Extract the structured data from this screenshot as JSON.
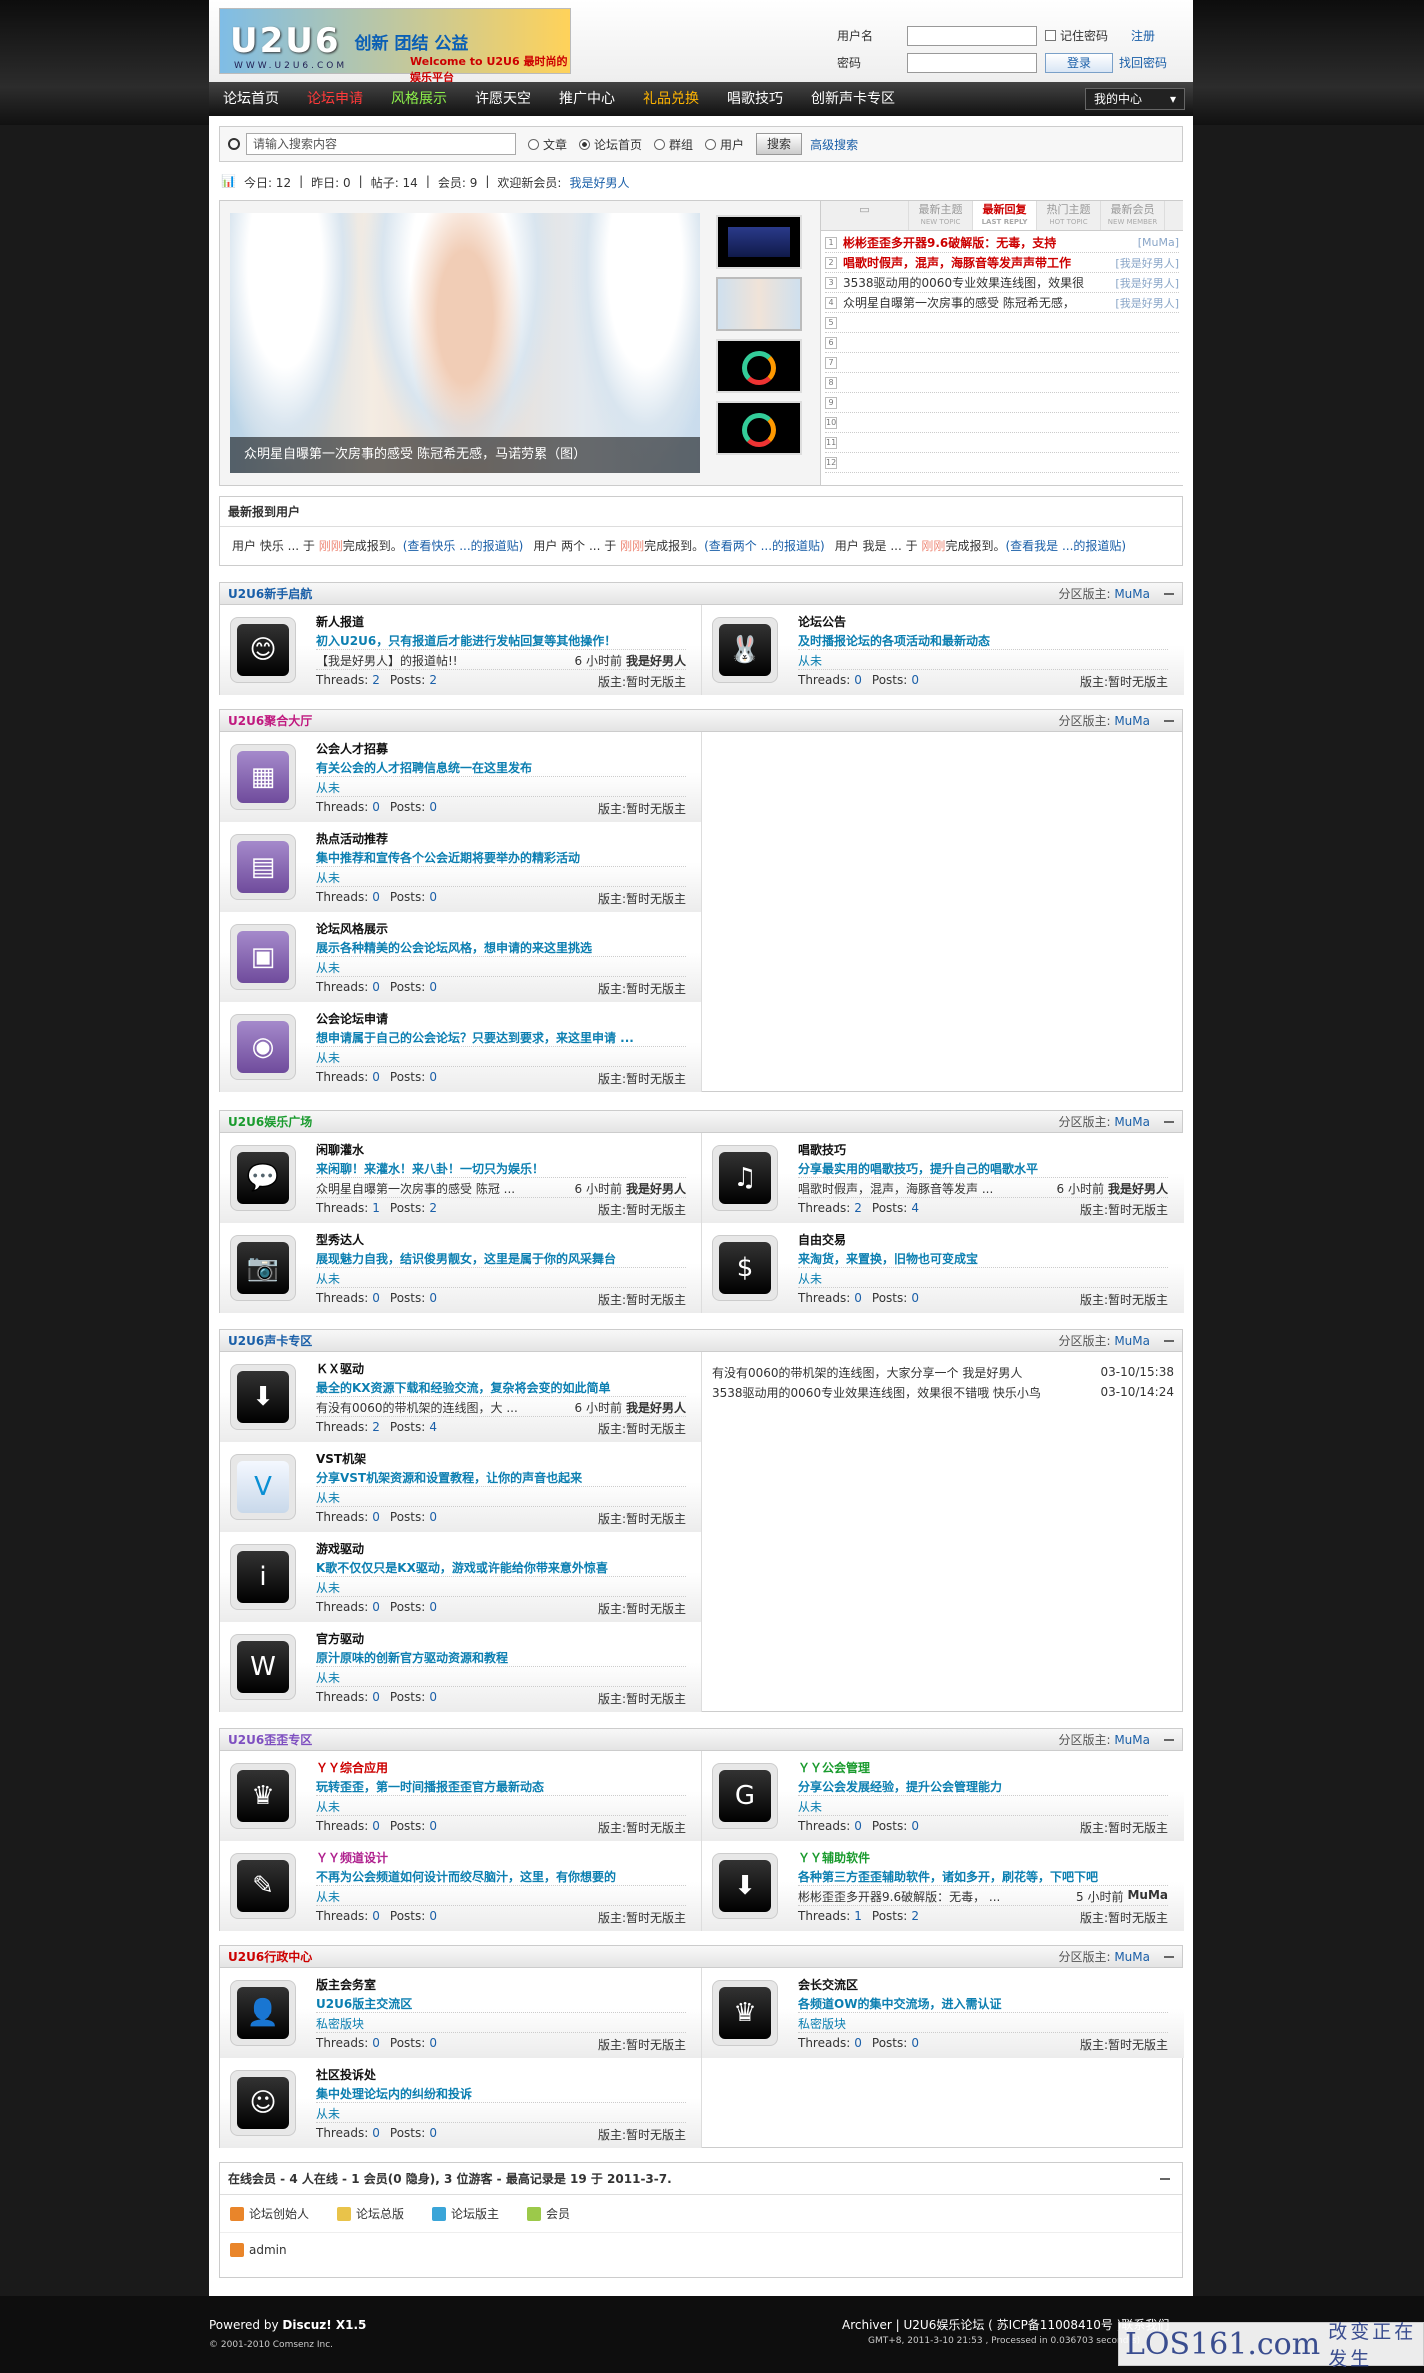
{
  "header": {
    "logo_text": "U2U6",
    "logo_slogan": "创新 团结 公益",
    "logo_sub": "Welcome to U2U6 最时尚的娱乐平台",
    "logo_url": "WWW.U2U6.COM",
    "username_label": "用户名",
    "password_label": "密码",
    "remember_label": "记住密码",
    "register_link": "注册",
    "login_button": "登录",
    "forgot_link": "找回密码"
  },
  "nav": {
    "items": [
      "论坛首页",
      "论坛申请",
      "风格展示",
      "许愿天空",
      "推广中心",
      "礼品兑换",
      "唱歌技巧",
      "创新声卡专区"
    ],
    "my_center": "我的中心"
  },
  "search": {
    "placeholder": "请输入搜索内容",
    "options": [
      "文章",
      "论坛首页",
      "群组",
      "用户"
    ],
    "button": "搜索",
    "advanced": "高级搜索"
  },
  "stats": {
    "today": "今日: 12",
    "yesterday": "昨日: 0",
    "posts": "帖子: 14",
    "members": "会员: 9",
    "welcome": "欢迎新会员:",
    "newest": "我是好男人"
  },
  "slideshow": {
    "caption": "众明星自曝第一次房事的感受 陈冠希无感，马诺劳累（图）"
  },
  "hot": {
    "tabs": [
      {
        "cn": "最新主题",
        "en": "NEW TOPIC"
      },
      {
        "cn": "最新回复",
        "en": "LAST REPLY"
      },
      {
        "cn": "热门主题",
        "en": "HOT TOPIC"
      },
      {
        "cn": "最新会员",
        "en": "NEW MEMBER"
      }
    ],
    "items": [
      {
        "n": "1",
        "title": "彬彬歪歪多开器9.6破解版：无毒，支持",
        "author": "[MuMa]",
        "red": true
      },
      {
        "n": "2",
        "title": "唱歌时假声，混声，海豚音等发声声带工作",
        "author": "[我是好男人]",
        "red": true
      },
      {
        "n": "3",
        "title": "3538驱动用的0060专业效果连线图，效果很",
        "author": "[我是好男人]",
        "red": false
      },
      {
        "n": "4",
        "title": "众明星自曝第一次房事的感受 陈冠希无感，",
        "author": "[我是好男人]",
        "red": false
      },
      {
        "n": "5",
        "title": "",
        "author": "",
        "red": false
      },
      {
        "n": "6",
        "title": "",
        "author": "",
        "red": false
      },
      {
        "n": "7",
        "title": "",
        "author": "",
        "red": false
      },
      {
        "n": "8",
        "title": "",
        "author": "",
        "red": false
      },
      {
        "n": "9",
        "title": "",
        "author": "",
        "red": false
      },
      {
        "n": "10",
        "title": "",
        "author": "",
        "red": false
      },
      {
        "n": "11",
        "title": "",
        "author": "",
        "red": false
      },
      {
        "n": "12",
        "title": "",
        "author": "",
        "red": false
      }
    ]
  },
  "newusers": {
    "title": "最新报到用户",
    "entries": [
      {
        "a": "用户 快乐 ... 于 ",
        "t": "刚刚",
        "b": "完成报到。",
        "link": "(查看快乐 ...的报道贴)"
      },
      {
        "a": "用户 两个 ... 于 ",
        "t": "刚刚",
        "b": "完成报到。",
        "link": "(查看两个 ...的报道贴)"
      },
      {
        "a": "用户 我是 ... 于 ",
        "t": "刚刚",
        "b": "完成报到。",
        "link": "(查看我是 ...的报道贴)"
      }
    ]
  },
  "common": {
    "mod_label": "分区版主:",
    "mod_name": "MuMa",
    "threads": "Threads:",
    "posts": "Posts:",
    "forum_mod": "版主:暂时无版主",
    "never": "从未",
    "private": "私密版块"
  },
  "groups": [
    {
      "title": "U2U6新手启航",
      "color": "#1a5fa8",
      "forums": [
        {
          "name": "新人报道",
          "desc": "初入U2U6，只有报道后才能进行发帖回复等其他操作！",
          "last": "【我是好男人】的报道帖!!",
          "ago": "6 小时前",
          "by": "我是好男人",
          "threads": "2",
          "posts": "2"
        },
        {
          "name": "论坛公告",
          "desc": "及时播报论坛的各项活动和最新动态",
          "last": "从未",
          "ago": "",
          "by": "",
          "threads": "0",
          "posts": "0"
        }
      ]
    },
    {
      "title": "U2U6聚合大厅",
      "color": "#c0197f",
      "forums": [
        {
          "name": "公会人才招募",
          "desc": "有关公会的人才招聘信息统一在这里发布",
          "last": "从未",
          "ago": "",
          "by": "",
          "threads": "0",
          "posts": "0"
        },
        {
          "name": "热点活动推荐",
          "desc": "集中推荐和宣传各个公会近期将要举办的精彩活动",
          "last": "从未",
          "ago": "",
          "by": "",
          "threads": "0",
          "posts": "0"
        },
        {
          "name": "论坛风格展示",
          "desc": "展示各种精美的公会论坛风格，想申请的来这里挑选",
          "last": "从未",
          "ago": "",
          "by": "",
          "threads": "0",
          "posts": "0"
        },
        {
          "name": "公会论坛申请",
          "desc": "想申请属于自己的公会论坛？只要达到要求，来这里申请 ...",
          "last": "从未",
          "ago": "",
          "by": "",
          "threads": "0",
          "posts": "0"
        }
      ]
    },
    {
      "title": "U2U6娱乐广场",
      "color": "#1a9b2e",
      "forums": [
        {
          "name": "闲聊灌水",
          "desc": "来闲聊！来灌水！来八卦！一切只为娱乐！",
          "last": "众明星自曝第一次房事的感受 陈冠 ...",
          "ago": "6 小时前",
          "by": "我是好男人",
          "threads": "1",
          "posts": "2"
        },
        {
          "name": "唱歌技巧",
          "desc": "分享最实用的唱歌技巧，提升自己的唱歌水平",
          "last": "唱歌时假声，混声，海豚音等发声 ...",
          "ago": "6 小时前",
          "by": "我是好男人",
          "threads": "2",
          "posts": "4"
        },
        {
          "name": "型秀达人",
          "desc": "展现魅力自我，结识俊男靓女，这里是属于你的风采舞台",
          "last": "从未",
          "ago": "",
          "by": "",
          "threads": "0",
          "posts": "0"
        },
        {
          "name": "自由交易",
          "desc": "来淘货，来置换，旧物也可变成宝",
          "last": "从未",
          "ago": "",
          "by": "",
          "threads": "0",
          "posts": "0"
        }
      ]
    },
    {
      "title": "U2U6声卡专区",
      "color": "#1a5fa8",
      "forums": [
        {
          "name": "ＫＸ驱动",
          "desc": "最全的KX资源下载和经验交流，复杂将会变的如此简单",
          "last": "有没有0060的带机架的连线图，大 ...",
          "ago": "6 小时前",
          "by": "我是好男人",
          "threads": "2",
          "posts": "4"
        },
        {
          "name": "VST机架",
          "desc": "分享VST机架资源和设置教程，让你的声音也起来",
          "last": "从未",
          "ago": "",
          "by": "",
          "threads": "0",
          "posts": "0"
        },
        {
          "name": "游戏驱动",
          "desc": "K歌不仅仅只是KX驱动，游戏或许能给你带来意外惊喜",
          "last": "从未",
          "ago": "",
          "by": "",
          "threads": "0",
          "posts": "0"
        },
        {
          "name": "官方驱动",
          "desc": "原汁原味的创新官方驱动资源和教程",
          "last": "从未",
          "ago": "",
          "by": "",
          "threads": "0",
          "posts": "0"
        }
      ],
      "side": [
        {
          "t": "有没有0060的带机架的连线图，大家分享一个  我是好男人",
          "d": "03-10/15:38"
        },
        {
          "t": "3538驱动用的0060专业效果连线图，效果很不错哦  快乐小鸟",
          "d": "03-10/14:24"
        }
      ]
    },
    {
      "title": "U2U6歪歪专区",
      "color": "#7e4fc0",
      "forums": [
        {
          "name": "ＹＹ综合应用",
          "desc": "玩转歪歪，第一时间播报歪歪官方最新动态",
          "last": "从未",
          "ago": "",
          "by": "",
          "threads": "0",
          "posts": "0"
        },
        {
          "name": "ＹＹ公会管理",
          "desc": "分享公会发展经验，提升公会管理能力",
          "last": "从未",
          "ago": "",
          "by": "",
          "threads": "0",
          "posts": "0"
        },
        {
          "name": "ＹＹ频道设计",
          "desc": "不再为公会频道如何设计而绞尽脑汁，这里，有你想要的",
          "last": "从未",
          "ago": "",
          "by": "",
          "threads": "0",
          "posts": "0"
        },
        {
          "name": "ＹＹ辅助软件",
          "desc": "各种第三方歪歪辅助软件，诸如多开，刷花等，下吧下吧",
          "last": "彬彬歪歪多开器9.6破解版：无毒， ...",
          "ago": "5 小时前",
          "by": "MuMa",
          "threads": "1",
          "posts": "2"
        }
      ]
    },
    {
      "title": "U2U6行政中心",
      "color": "#c00",
      "forums": [
        {
          "name": "版主会务室",
          "desc": "U2U6版主交流区",
          "last": "私密版块",
          "ago": "",
          "by": "",
          "threads": "0",
          "posts": "0"
        },
        {
          "name": "会长交流区",
          "desc": "各频道OW的集中交流场，进入需认证",
          "last": "私密版块",
          "ago": "",
          "by": "",
          "threads": "0",
          "posts": "0"
        },
        {
          "name": "社区投诉处",
          "desc": "集中处理论坛内的纠纷和投诉",
          "last": "从未",
          "ago": "",
          "by": "",
          "threads": "0",
          "posts": "0"
        }
      ]
    }
  ],
  "online": {
    "title": "在线会员 - 4 人在线 - 1 会员(0 隐身), 3 位游客 - 最高记录是 19 于 2011-3-7.",
    "legend": [
      "论坛创始人",
      "论坛总版",
      "论坛版主",
      "会员"
    ],
    "users": [
      "admin"
    ]
  },
  "footer": {
    "powered": "Powered by ",
    "discuz": "Discuz! X1.5",
    "copyright": "© 2001-2010 Comsenz Inc.",
    "archiver": "Archiver | U2U6娱乐论坛 ( 苏ICP备11008410号 )联系我们",
    "gmt": "GMT+8, 2011-3-10 21:53 , Processed in 0.036703 second(s)",
    "watermark_big": "LOS161.com",
    "watermark_cn": "改变正在发生"
  },
  "colors": {
    "accent": "#1a5fa8",
    "nav_bg": "#222222",
    "hot_red": "#cc0000"
  }
}
